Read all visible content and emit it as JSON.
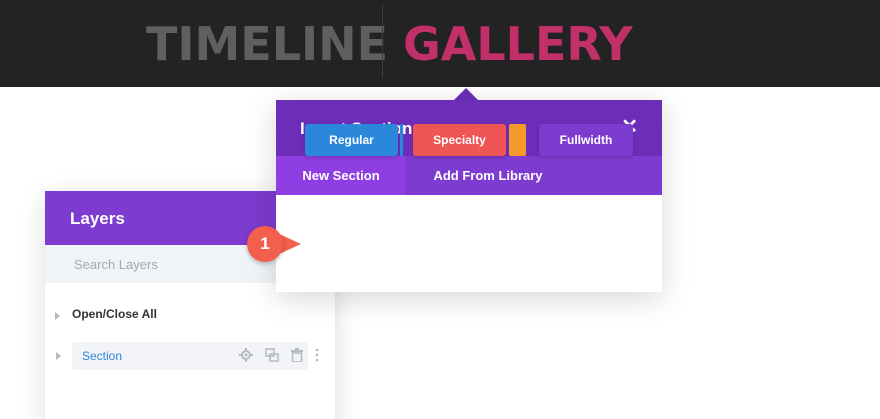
{
  "banner": {
    "word1": "TIMELINE",
    "word2": "GALLERY",
    "colors": {
      "word1": "#5f5f5f",
      "word2": "#c2306a",
      "background": "#232323"
    }
  },
  "layers": {
    "title": "Layers",
    "search_placeholder": "Search Layers",
    "open_close_all": "Open/Close All",
    "section_label": "Section",
    "icons": [
      "gear-icon",
      "duplicate-icon",
      "trash-icon",
      "more-icon"
    ]
  },
  "modal": {
    "title": "Insert Section",
    "close_glyph": "✕",
    "tabs": [
      {
        "label": "New Section",
        "active": true
      },
      {
        "label": "Add From Library",
        "active": false
      }
    ],
    "buttons": {
      "regular": "Regular",
      "specialty": "Specialty",
      "fullwidth": "Fullwidth"
    }
  },
  "callout": {
    "number": "1"
  },
  "colors": {
    "purple_dark": "#6c2eb9",
    "purple": "#7e3bd0",
    "blue": "#2b87da",
    "red": "#ef5555",
    "orange": "#f59a2a",
    "callout": "#f25f4c"
  }
}
